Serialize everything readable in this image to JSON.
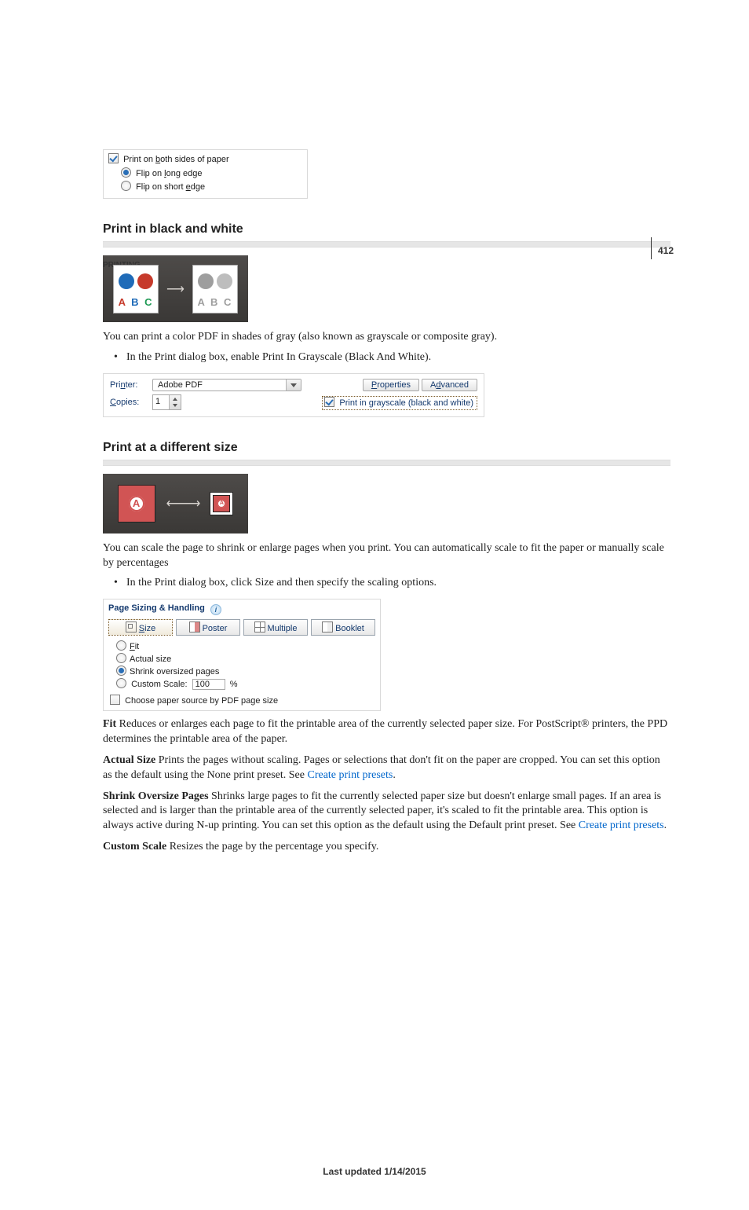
{
  "page_number": "412",
  "breadcrumb": "Printing",
  "footer": "Last updated 1/14/2015",
  "fig1": {
    "both_sides_pre": "Print on ",
    "both_sides_u": "b",
    "both_sides_post": "oth sides of paper",
    "long_pre": "Flip on ",
    "long_u": "l",
    "long_post": "ong edge",
    "short_pre": "Flip on short ",
    "short_u": "e",
    "short_post": "dge"
  },
  "sec_bw": {
    "heading": "Print in black and white",
    "body": "You can print a color PDF in shades of gray (also known as grayscale or composite gray).",
    "bullet": "In the Print dialog box, enable Print In Grayscale (Black And White)."
  },
  "fig2": {
    "letters_color_A": "A",
    "letters_color_B": "B",
    "letters_color_C": "C",
    "letters_gray": "A B C"
  },
  "fig3": {
    "printer_lbl_pre": "Pri",
    "printer_lbl_u": "n",
    "printer_lbl_post": "ter:",
    "printer_value": "Adobe PDF",
    "copies_lbl_u": "C",
    "copies_lbl_post": "opies:",
    "copies_value": "1",
    "properties_u": "P",
    "properties_post": "roperties",
    "advanced_pre": "A",
    "advanced_u": "d",
    "advanced_post": "vanced",
    "grayscale_pre": "Print in ",
    "grayscale_u": "g",
    "grayscale_post": "rayscale (black and white)"
  },
  "sec_size": {
    "heading": "Print at a different size",
    "body": "You can scale the page to shrink or enlarge pages when you print. You can automatically scale to fit the paper or manually scale by percentages",
    "bullet": "In the Print dialog box, click Size and then specify the scaling options."
  },
  "fig4": {
    "A": "A"
  },
  "fig5": {
    "title": "Page Sizing & Handling",
    "size_u": "S",
    "size_post": "ize",
    "poster": "Poster",
    "multiple": "Multiple",
    "booklet": "Booklet",
    "fit_u": "F",
    "fit_post": "it",
    "actual": "Actual size",
    "shrink": "Shrink oversized pages",
    "custom": "Custom Scale:",
    "custom_val": "100",
    "pct": "%",
    "choose": "Choose paper source by PDF page size"
  },
  "defs": {
    "fit_term": "Fit",
    "fit_body": " Reduces or enlarges each page to fit the printable area of the currently selected paper size. For PostScript® printers, the PPD determines the printable area of the paper.",
    "actual_term": "Actual Size",
    "actual_body": " Prints the pages without scaling. Pages or selections that don't fit on the paper are cropped. You can set this option as the default using the None print preset. See ",
    "link": "Create print presets",
    "period": ".",
    "shrink_term": "Shrink Oversize Pages",
    "shrink_body": " Shrinks large pages to fit the currently selected paper size but doesn't enlarge small pages. If an area is selected and is larger than the printable area of the currently selected paper, it's scaled to fit the printable area. This option is always active during N-up printing. You can set this option as the default using the Default print preset. See ",
    "custom_term": "Custom Scale",
    "custom_body": " Resizes the page by the percentage you specify."
  }
}
